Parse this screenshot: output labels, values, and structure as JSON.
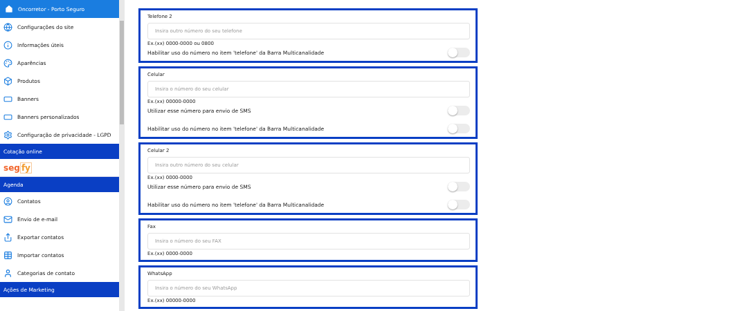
{
  "sidebar": {
    "items": [
      {
        "kind": "header",
        "label": "Oncorretor - Porto Seguro"
      },
      {
        "kind": "item",
        "label": "Configurações do site"
      },
      {
        "kind": "item",
        "label": "Informações úteis"
      },
      {
        "kind": "item",
        "label": "Aparências"
      },
      {
        "kind": "item",
        "label": "Produtos"
      },
      {
        "kind": "item",
        "label": "Banners"
      },
      {
        "kind": "item",
        "label": "Banners personalizados"
      },
      {
        "kind": "item",
        "label": "Configuração de privacidade - LGPD"
      },
      {
        "kind": "section",
        "label": "Cotação online"
      },
      {
        "kind": "logo",
        "parts": [
          "seg",
          "fy"
        ]
      },
      {
        "kind": "section",
        "label": "Agenda"
      },
      {
        "kind": "item",
        "label": "Contatos"
      },
      {
        "kind": "item",
        "label": "Envio de e-mail"
      },
      {
        "kind": "item",
        "label": "Exportar contatos"
      },
      {
        "kind": "item",
        "label": "Importar contatos"
      },
      {
        "kind": "item",
        "label": "Categorias de contato"
      },
      {
        "kind": "section",
        "label": "Ações de Marketing"
      }
    ]
  },
  "cards": [
    {
      "label": "Telefone 2",
      "placeholder": "Insira outro número do seu telefone",
      "hint": "Ex.(xx) 0000-0000 ou 0800",
      "toggles": [
        {
          "label": "Habilitar uso do número no item 'telefone' da Barra Multicanalidade",
          "on": false
        }
      ]
    },
    {
      "label": "Celular",
      "placeholder": "Insira o número do seu celular",
      "hint": "Ex.(xx) 00000-0000",
      "toggles": [
        {
          "label": "Utilizar esse número para envio de SMS",
          "on": false
        },
        {
          "label": "Habilitar uso do número no item 'telefone' da Barra Multicanalidade",
          "on": false
        }
      ]
    },
    {
      "label": "Celular 2",
      "placeholder": "Insira outro número do seu celular",
      "hint": "Ex.(xx) 0000-0000",
      "toggles": [
        {
          "label": "Utilizar esse número para envio de SMS",
          "on": false
        },
        {
          "label": "Habilitar uso do número no item 'telefone' da Barra Multicanalidade",
          "on": false
        }
      ]
    },
    {
      "label": "Fax",
      "placeholder": "Insira o número do seu FAX",
      "hint": "Ex.(xx) 0000-0000"
    },
    {
      "label": "WhatsApp",
      "placeholder": "Insira o número do seu WhatsApp",
      "hint": "Ex.(xx) 00000-0000"
    }
  ]
}
